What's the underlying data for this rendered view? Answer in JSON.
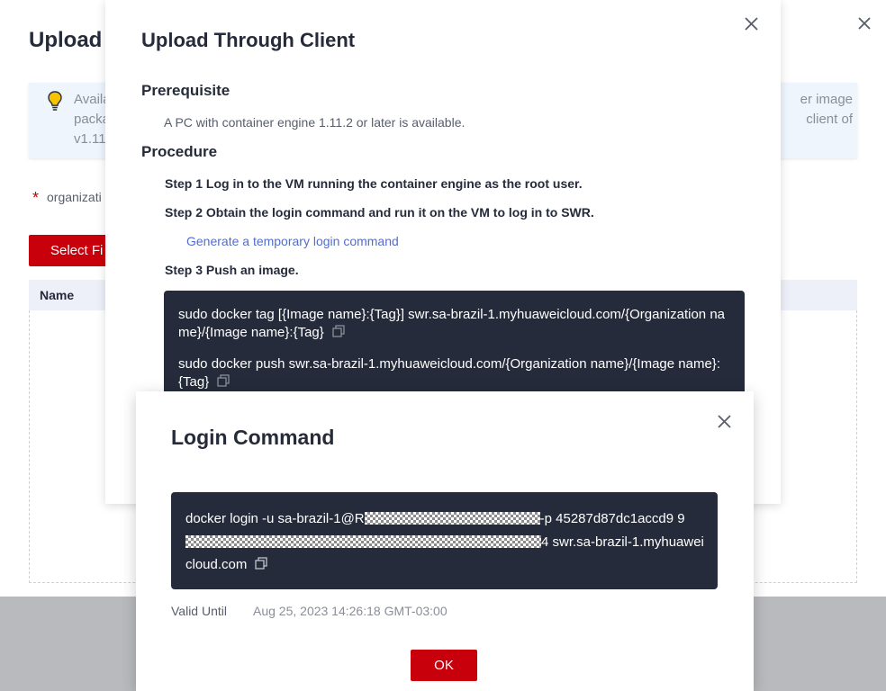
{
  "background_dialog": {
    "title": "Upload T",
    "info_left": "Availa packa v1.11",
    "info_right": "er image client of",
    "org_label": "organizati",
    "select_file_button": "Select Fi",
    "table_header_name": "Name"
  },
  "client_dialog": {
    "title": "Upload Through Client",
    "prerequisite_heading": "Prerequisite",
    "prerequisite_text": "A PC with container engine 1.11.2 or later is available.",
    "procedure_heading": "Procedure",
    "step1": "Step 1 Log in to the VM running the container engine as the root user.",
    "step2": "Step 2 Obtain the login command and run it on the VM to log in to SWR.",
    "generate_link": "Generate a temporary login command",
    "step3": "Step 3 Push an image.",
    "tag_command": "sudo docker tag [{Image name}:{Tag}] swr.sa-brazil-1.myhuaweicloud.com/{Organization name}/{Image name}:{Tag}",
    "push_command": "sudo docker push swr.sa-brazil-1.myhuaweicloud.com/{Organization name}/{Image name}:{Tag}"
  },
  "login_dialog": {
    "title": "Login Command",
    "command_part1": "docker login -u sa-brazil-1@R",
    "command_part2": "-p 45287d87dc1accd9 9",
    "command_part3": "4 swr.sa-brazil-1.myhuaweicloud.com",
    "valid_label": "Valid Until",
    "valid_value": "Aug 25, 2023 14:26:18 GMT-03:00",
    "ok_button": "OK"
  },
  "colors": {
    "brand_red": "#c7000b",
    "code_bg": "#252b3a",
    "link_blue": "#526ecc",
    "info_bg": "#eef5fd"
  }
}
